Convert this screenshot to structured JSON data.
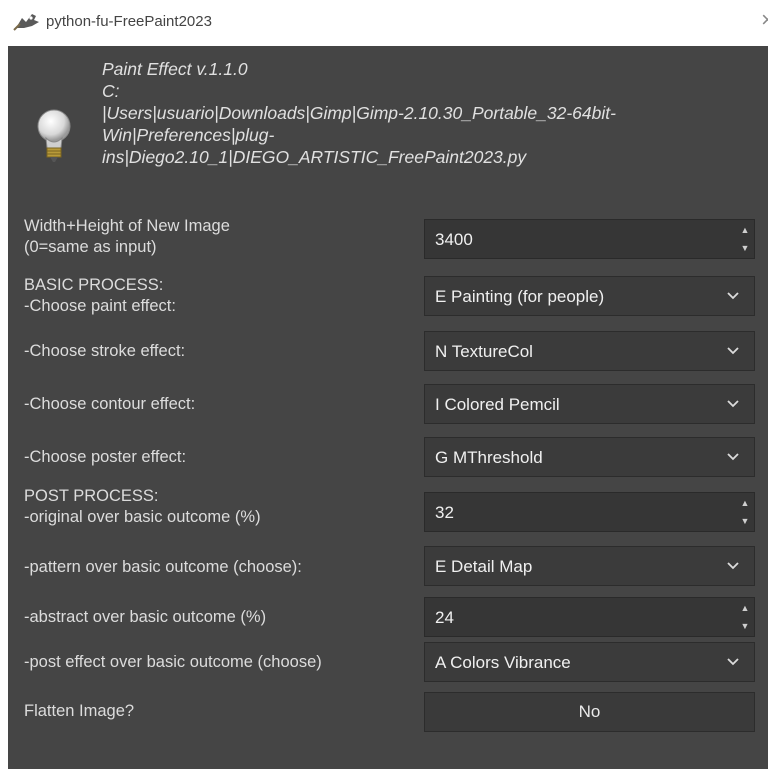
{
  "window": {
    "title": "python-fu-FreePaint2023",
    "close_glyph": "×"
  },
  "header": {
    "lines": [
      "Paint Effect v.1.1.0",
      "C:",
      "|Users|usuario|Downloads|Gimp|Gimp-2.10.30_Portable_32-64bit-",
      "Win|Preferences|plug-",
      "ins|Diego2.10_1|DIEGO_ARTISTIC_FreePaint2023.py"
    ],
    "icon": "lightbulb-icon"
  },
  "fields": {
    "size": {
      "label1": "Width+Height of New Image",
      "label2": " (0=same as input)",
      "value": "3400"
    },
    "paint": {
      "label1": "BASIC PROCESS:",
      "label2": " -Choose paint effect:",
      "value": "E Painting (for people)"
    },
    "stroke": {
      "label": " -Choose stroke effect:",
      "value": "N TextureCol"
    },
    "contour": {
      "label": " -Choose contour effect:",
      "value": "I Colored Pemcil"
    },
    "poster": {
      "label": " -Choose poster effect:",
      "value": "G MThreshold"
    },
    "original": {
      "label1": "POST PROCESS:",
      "label2": " -original over basic outcome (%)",
      "value": "32"
    },
    "pattern": {
      "label": "-pattern over basic outcome (choose):",
      "value": "E Detail Map"
    },
    "abstract": {
      "label": "-abstract over basic outcome (%)",
      "value": "24"
    },
    "post": {
      "label": "-post effect over basic outcome (choose)",
      "value": "A Colors Vibrance"
    },
    "flatten": {
      "label": "Flatten Image?",
      "value": "No"
    }
  },
  "colors": {
    "panel": "#454545",
    "field": "#363636",
    "text": "#dcdcdc"
  }
}
